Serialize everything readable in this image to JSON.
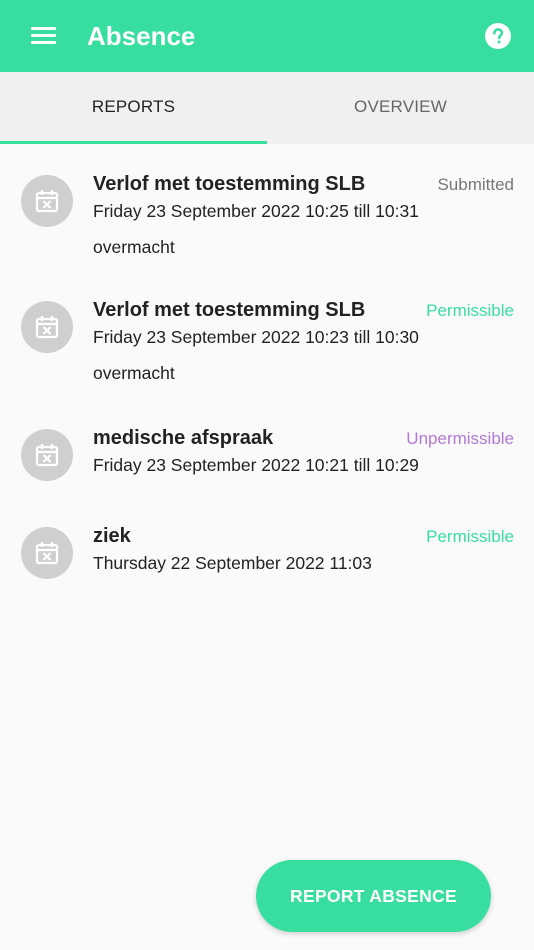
{
  "header": {
    "title": "Absence",
    "menu_icon": "menu-icon",
    "help_icon": "help-icon"
  },
  "tabs": [
    {
      "label": "REPORTS",
      "active": true
    },
    {
      "label": "OVERVIEW",
      "active": false
    }
  ],
  "colors": {
    "accent": "#38de9f",
    "submitted": "#777777",
    "permissible": "#38de9f",
    "unpermissible": "#b27ad6"
  },
  "reports": [
    {
      "title": "Verlof met toestemming SLB",
      "status": "Submitted",
      "time": "Friday 23 September 2022 10:25 till 10:31",
      "note": "overmacht"
    },
    {
      "title": "Verlof met toestemming SLB",
      "status": "Permissible",
      "time": "Friday 23 September 2022 10:23 till 10:30",
      "note": "overmacht"
    },
    {
      "title": "medische afspraak",
      "status": "Unpermissible",
      "time": "Friday 23 September 2022 10:21 till 10:29"
    },
    {
      "title": "ziek",
      "status": "Permissible",
      "time": "Thursday 22 September 2022 11:03"
    }
  ],
  "fab": {
    "label": "REPORT ABSENCE"
  }
}
